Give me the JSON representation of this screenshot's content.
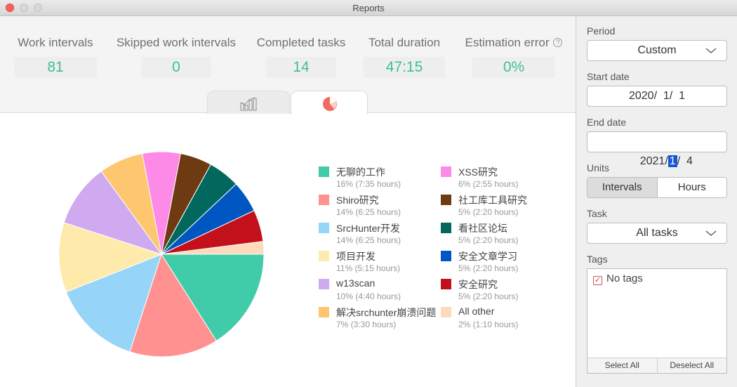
{
  "window": {
    "title": "Reports"
  },
  "stats": [
    {
      "label": "Work intervals",
      "value": "81"
    },
    {
      "label": "Skipped work intervals",
      "value": "0"
    },
    {
      "label": "Completed tasks",
      "value": "14"
    },
    {
      "label": "Total duration",
      "value": "47:15"
    },
    {
      "label": "Estimation error",
      "value": "0%"
    }
  ],
  "help_icon": "?",
  "tabs": [
    {
      "name": "bar-chart-tab",
      "icon": "bar-chart-icon",
      "active": false
    },
    {
      "name": "pie-chart-tab",
      "icon": "pie-chart-icon",
      "active": true
    }
  ],
  "chart_data": {
    "type": "pie",
    "slices": [
      {
        "name": "无聊的工作",
        "value": 16,
        "detail": "16% (7:35 hours)",
        "color": "#40cca8"
      },
      {
        "name": "Shiro研究",
        "value": 14,
        "detail": "14% (6:25 hours)",
        "color": "#ff9191"
      },
      {
        "name": "SrcHunter开发",
        "value": 14,
        "detail": "14% (6:25 hours)",
        "color": "#96d5f7"
      },
      {
        "name": "项目开发",
        "value": 11,
        "detail": "11% (5:15 hours)",
        "color": "#feeaaa"
      },
      {
        "name": "w13scan",
        "value": 10,
        "detail": "10% (4:40 hours)",
        "color": "#cfaaf0"
      },
      {
        "name": "解决srchunter崩溃问题",
        "value": 7,
        "detail": "7% (3:30 hours)",
        "color": "#fec66f"
      },
      {
        "name": "XSS研究",
        "value": 6,
        "detail": "6% (2:55 hours)",
        "color": "#fc8ae6"
      },
      {
        "name": "社工库工具研究",
        "value": 5,
        "detail": "5% (2:20 hours)",
        "color": "#6d3a12"
      },
      {
        "name": "看社区论坛",
        "value": 5,
        "detail": "5% (2:20 hours)",
        "color": "#02685e"
      },
      {
        "name": "安全文章学习",
        "value": 5,
        "detail": "5% (2:20 hours)",
        "color": "#0057c1"
      },
      {
        "name": "安全研究",
        "value": 5,
        "detail": "5% (2:20 hours)",
        "color": "#c2111a"
      },
      {
        "name": "All other",
        "value": 2,
        "detail": "2% (1:10 hours)",
        "color": "#fed9bb"
      }
    ]
  },
  "sidebar": {
    "period_label": "Period",
    "period_value": "Custom",
    "start_label": "Start date",
    "start_value": "2020/  1/  1",
    "end_label": "End date",
    "end_year": "2021/",
    "end_month": "1",
    "end_day": "/  4",
    "units_label": "Units",
    "units_options": [
      "Intervals",
      "Hours"
    ],
    "units_selected": "Intervals",
    "task_label": "Task",
    "task_value": "All tasks",
    "tags_label": "Tags",
    "tag_item": "No tags",
    "tag_checked": true,
    "select_all": "Select All",
    "deselect_all": "Deselect All"
  },
  "colors": {
    "accent": "#3fbf94",
    "close": "#fc605b",
    "selection": "#1457d4"
  }
}
